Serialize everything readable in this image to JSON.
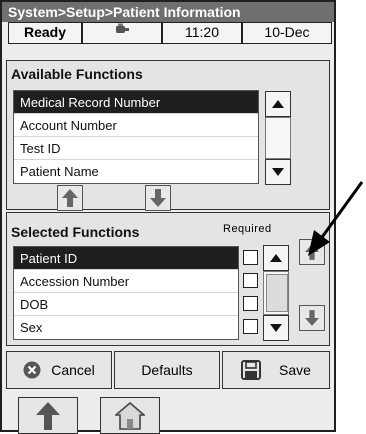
{
  "header": {
    "title": "System>Setup>Patient Information"
  },
  "status_bar": {
    "state": "Ready",
    "icon": "sample-tube-icon",
    "time": "11:20",
    "date": "10-Dec"
  },
  "available": {
    "heading": "Available Functions",
    "items": [
      {
        "label": "Medical Record Number",
        "selected": true
      },
      {
        "label": "Account Number",
        "selected": false
      },
      {
        "label": "Test ID",
        "selected": false
      },
      {
        "label": "Patient Name",
        "selected": false
      }
    ]
  },
  "selected_functions": {
    "heading": "Selected Functions",
    "required_label": "Required",
    "items": [
      {
        "label": "Patient ID",
        "selected": true,
        "required": false
      },
      {
        "label": "Accession Number",
        "selected": false,
        "required": false
      },
      {
        "label": "DOB",
        "selected": false,
        "required": false
      },
      {
        "label": "Sex",
        "selected": false,
        "required": false
      }
    ]
  },
  "actions": {
    "cancel": "Cancel",
    "defaults": "Defaults",
    "save": "Save"
  },
  "colors": {
    "title_bar": "#6f6f6f",
    "selected_row": "#1f1f1f",
    "panel": "#e4e4e4"
  }
}
